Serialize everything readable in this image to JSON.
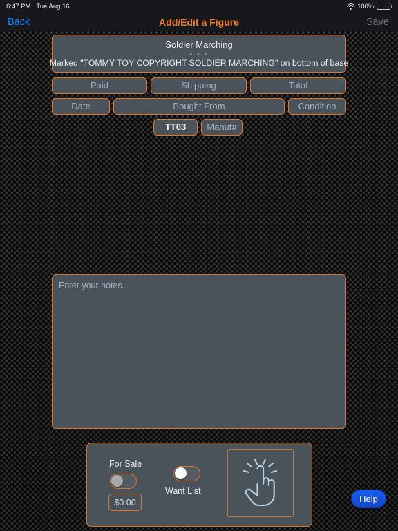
{
  "statusbar": {
    "time": "6:47 PM",
    "date": "Tue Aug 16",
    "battery_percent": "100%",
    "wifi_icon": "wifi-icon",
    "battery_icon": "battery-full-icon"
  },
  "navbar": {
    "back_label": "Back",
    "title": "Add/Edit a Figure",
    "save_label": "Save"
  },
  "header_box": {
    "figure_name": "Soldier Marching",
    "divider": "- - -",
    "description": "Marked \"TOMMY TOY COPYRIGHT SOLDIER MARCHING\" on bottom of base"
  },
  "fields": {
    "paid": {
      "label": "Paid",
      "value": ""
    },
    "shipping": {
      "label": "Shipping",
      "value": ""
    },
    "total": {
      "label": "Total",
      "value": ""
    },
    "date": {
      "label": "Date",
      "value": ""
    },
    "bought_from": {
      "label": "Bought From",
      "value": ""
    },
    "condition": {
      "label": "Condition",
      "value": ""
    },
    "catalog_number": {
      "label": "",
      "value": "TT03"
    },
    "manufacturer_number": {
      "label": "Manuf#",
      "value": ""
    }
  },
  "notes": {
    "placeholder": "Enter your notes...",
    "value": ""
  },
  "bottom_panel": {
    "for_sale_label": "For Sale",
    "for_sale_state": "off",
    "price_value": "$0.00",
    "want_list_label": "Want List",
    "want_list_state": "off",
    "tap_icon": "tap-hand-icon"
  },
  "help": {
    "label": "Help"
  },
  "colors": {
    "accent_orange": "#e2742a",
    "title_orange": "#f2792b",
    "link_blue": "#0b84ff",
    "help_blue": "#1a5df0",
    "field_fill": "#4a525a",
    "placeholder_text": "#9fb3c4"
  }
}
